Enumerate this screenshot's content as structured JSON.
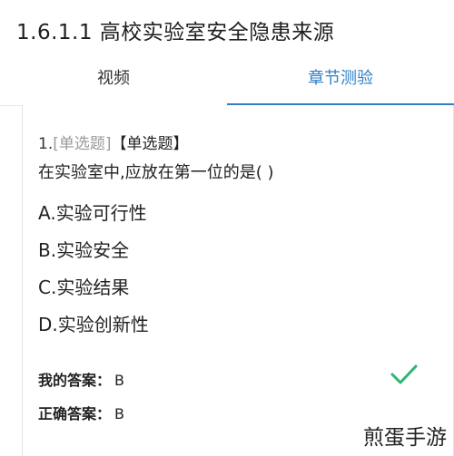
{
  "header": {
    "title": "1.6.1.1  高校实验室安全隐患来源"
  },
  "tabs": [
    {
      "label": "视频",
      "active": false
    },
    {
      "label": "章节测验",
      "active": true
    }
  ],
  "accent_color": "#2f80c9",
  "success_color": "#2bb673",
  "question": {
    "number": "1.",
    "type_tag": "[单选题]",
    "type_tag_bold": "【单选题】",
    "stem": "在实验室中,应放在第一位的是( )",
    "options": [
      "A.实验可行性",
      "B.实验安全",
      "C.实验结果",
      "D.实验创新性"
    ]
  },
  "answers": {
    "my_label": "我的答案：",
    "my_value": "B",
    "correct_label": "正确答案：",
    "correct_value": "B",
    "result_icon": "check-icon"
  },
  "watermark": "煎蛋手游"
}
